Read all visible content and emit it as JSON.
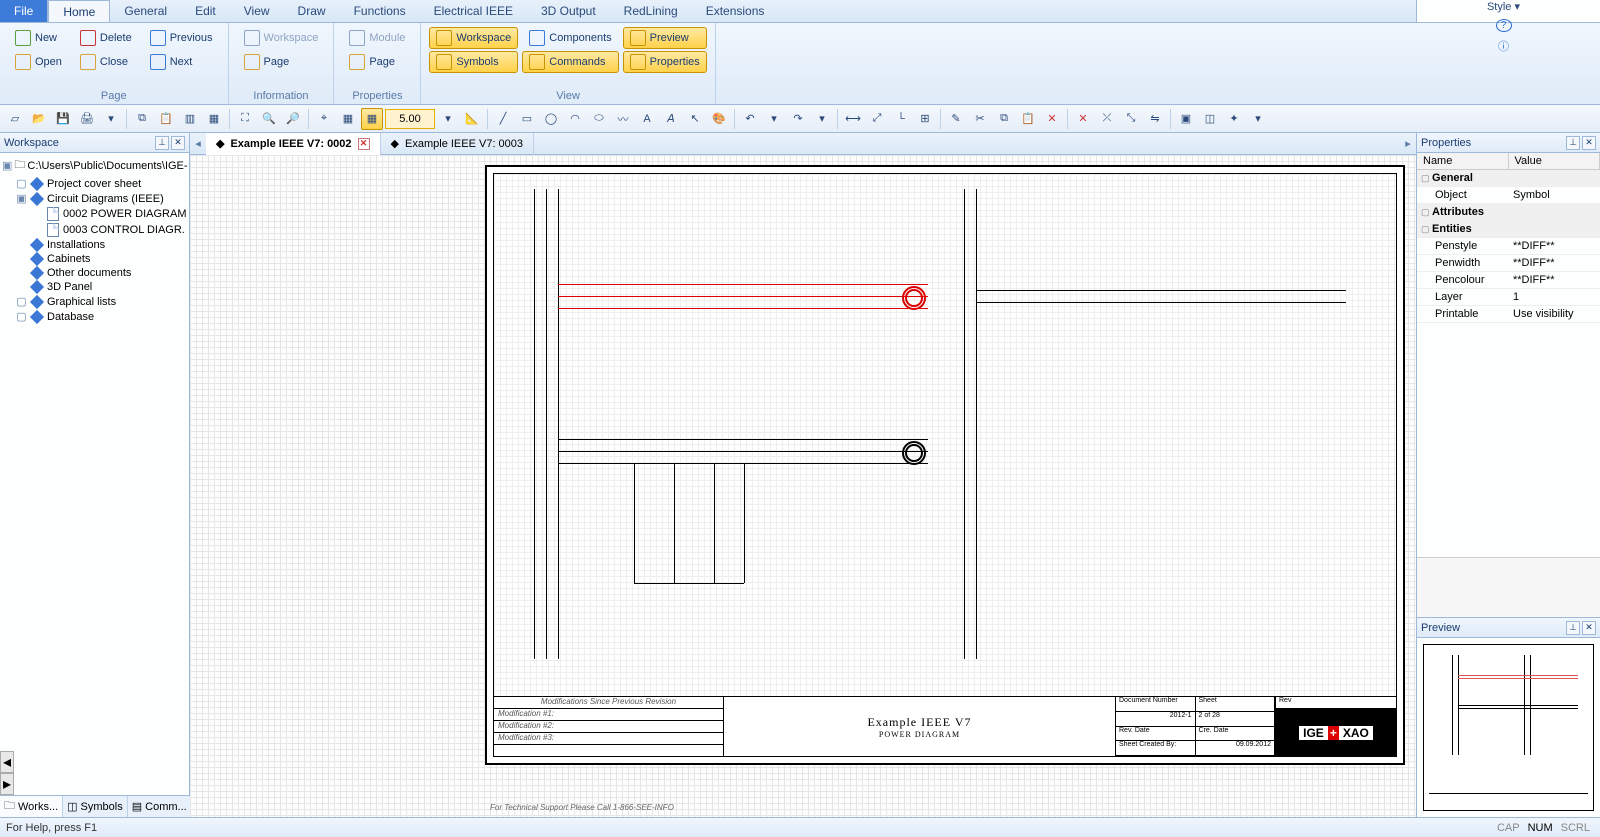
{
  "menubar": {
    "file": "File",
    "tabs": [
      "Home",
      "General",
      "Edit",
      "View",
      "Draw",
      "Functions",
      "Electrical IEEE",
      "3D Output",
      "RedLining",
      "Extensions"
    ],
    "active": "Home",
    "style": "Style"
  },
  "ribbon": {
    "groups": {
      "page": {
        "title": "Page",
        "new": "New",
        "delete": "Delete",
        "previous": "Previous",
        "open": "Open",
        "close": "Close",
        "next": "Next"
      },
      "information": {
        "title": "Information",
        "workspace": "Workspace",
        "page": "Page"
      },
      "properties": {
        "title": "Properties",
        "module": "Module",
        "page": "Page"
      },
      "view": {
        "title": "View",
        "workspace": "Workspace",
        "components": "Components",
        "preview": "Preview",
        "symbols": "Symbols",
        "commands": "Commands",
        "properties": "Properties"
      }
    }
  },
  "quickbar": {
    "grid_value": "5.00"
  },
  "workspace": {
    "title": "Workspace",
    "root": "C:\\Users\\Public\\Documents\\IGE-",
    "items": [
      {
        "label": "Project cover sheet",
        "icon": "diamond",
        "collapsed": true
      },
      {
        "label": "Circuit Diagrams (IEEE)",
        "icon": "diamond",
        "collapsed": false,
        "children": [
          {
            "label": "0002 POWER DIAGRAM",
            "icon": "page"
          },
          {
            "label": "0003 CONTROL DIAGR.",
            "icon": "page"
          }
        ]
      },
      {
        "label": "Installations",
        "icon": "diamond"
      },
      {
        "label": "Cabinets",
        "icon": "diamond"
      },
      {
        "label": "Other documents",
        "icon": "diamond"
      },
      {
        "label": "3D Panel",
        "icon": "diamond"
      },
      {
        "label": "Graphical lists",
        "icon": "diamond",
        "collapsed": true
      },
      {
        "label": "Database",
        "icon": "diamond",
        "collapsed": true
      }
    ],
    "bottom_tabs": [
      "Works...",
      "Symbols",
      "Comm..."
    ]
  },
  "doctabs": {
    "tabs": [
      {
        "label": "Example IEEE V7: 0002",
        "active": true,
        "closable": true
      },
      {
        "label": "Example IEEE V7: 0003",
        "active": false,
        "closable": false
      }
    ]
  },
  "drawing": {
    "title_block": {
      "mods_header": "Modifications Since Previous Revision",
      "mods": [
        "Modification #1:",
        "Modification #2:",
        "Modification #3:"
      ],
      "sheet_title": "Example IEEE V7",
      "sheet_sub": "POWER DIAGRAM",
      "doc_no_label": "Document Number",
      "doc_no": "2012-1",
      "sheet_label": "Sheet",
      "sheet_val": "2  of  28",
      "rev_date_label": "Rev. Date",
      "rev_date": "",
      "cre_date_label": "Cre. Date",
      "cre_date": "09.09.2012",
      "created_by_label": "Sheet Created By:",
      "created_by": "",
      "rev_label": "Rev",
      "logo1": "IGE",
      "logo2": "+",
      "logo3": "XAO"
    },
    "footer": "For Technical Support Please Call 1-866-SEE-INFO"
  },
  "properties": {
    "title": "Properties",
    "cols": {
      "name": "Name",
      "value": "Value"
    },
    "rows": [
      {
        "cat": true,
        "k": "General",
        "v": ""
      },
      {
        "k": "Object",
        "v": "Symbol"
      },
      {
        "cat": true,
        "k": "Attributes",
        "v": ""
      },
      {
        "cat": true,
        "k": "Entities",
        "v": ""
      },
      {
        "k": "Penstyle",
        "v": "**DIFF**"
      },
      {
        "k": "Penwidth",
        "v": "**DIFF**"
      },
      {
        "k": "Pencolour",
        "v": "**DIFF**"
      },
      {
        "k": "Layer",
        "v": "1"
      },
      {
        "k": "Printable",
        "v": "Use visibility"
      }
    ]
  },
  "preview": {
    "title": "Preview"
  },
  "statusbar": {
    "help": "For Help, press F1",
    "caps": "CAP",
    "num": "NUM",
    "scrl": "SCRL"
  }
}
